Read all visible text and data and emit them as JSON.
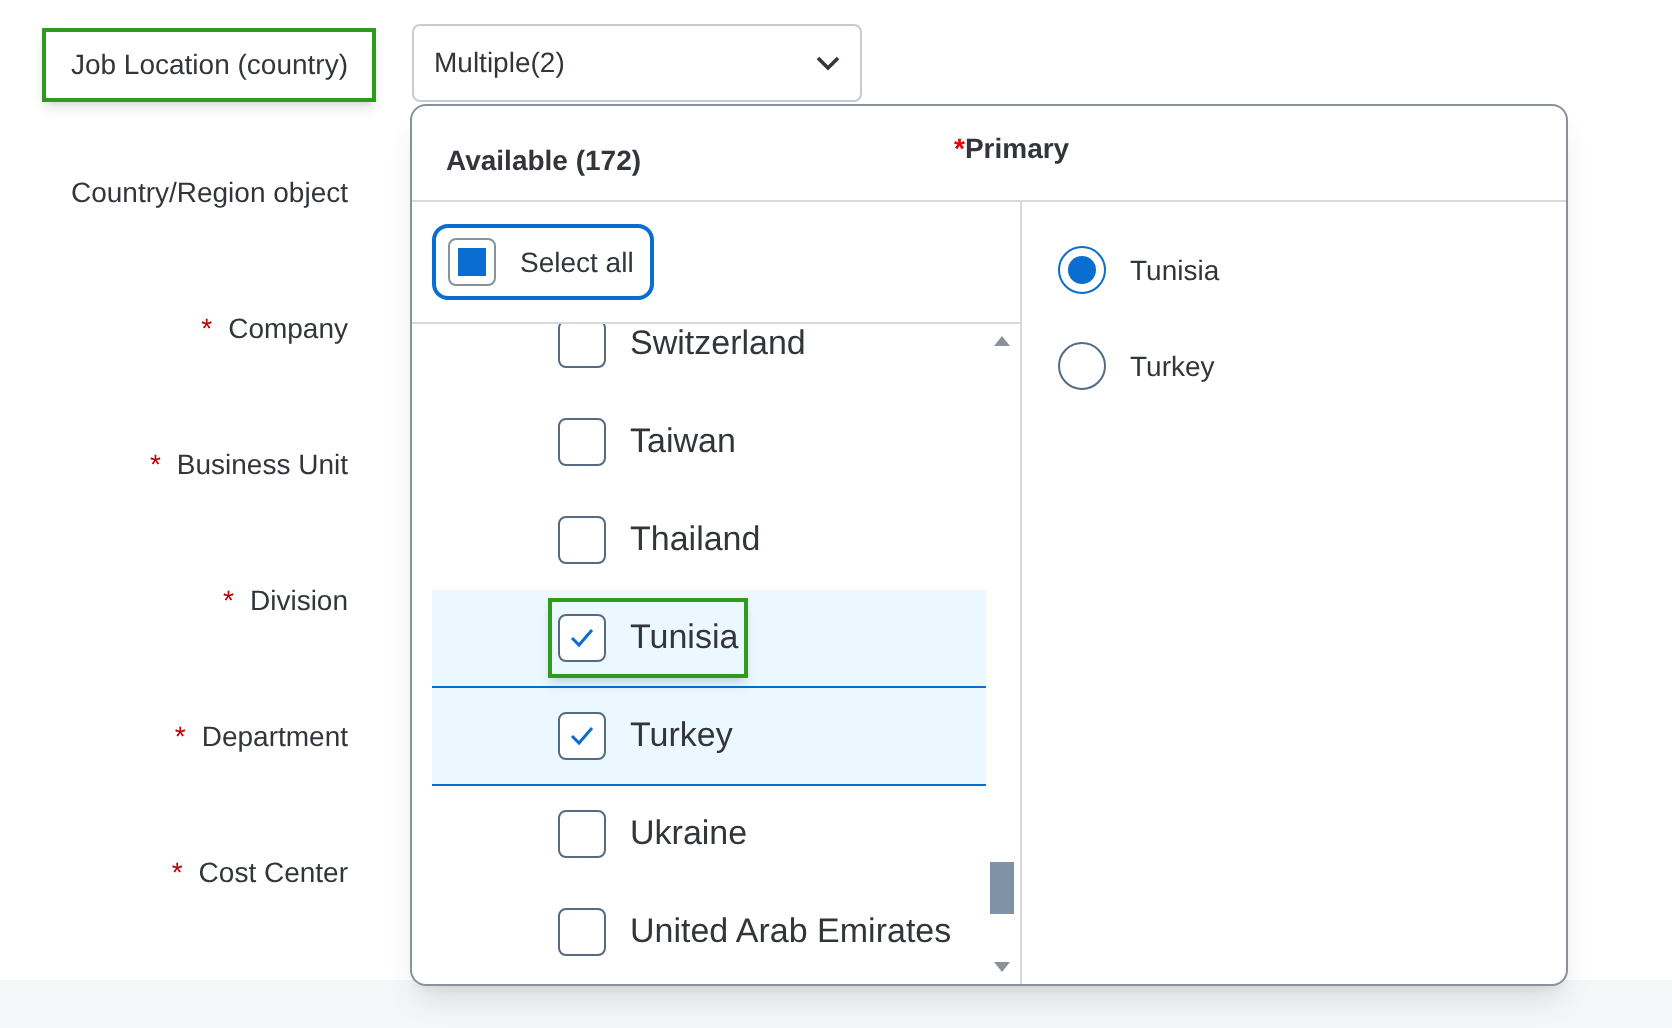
{
  "fields": [
    {
      "label": "Job Location (country)",
      "required": false,
      "highlighted": true
    },
    {
      "label": "Country/Region object",
      "required": false,
      "highlighted": false
    },
    {
      "label": "Company",
      "required": true,
      "required_mark": "*",
      "highlighted": false
    },
    {
      "label": "Business Unit",
      "required": true,
      "required_mark": "*",
      "highlighted": false
    },
    {
      "label": "Division",
      "required": true,
      "required_mark": "*",
      "highlighted": false
    },
    {
      "label": "Department",
      "required": true,
      "required_mark": "*",
      "highlighted": false
    },
    {
      "label": "Cost Center",
      "required": true,
      "required_mark": "*",
      "highlighted": false
    }
  ],
  "dropdown": {
    "value": "Multiple(2)"
  },
  "popup": {
    "available_title": "Available (172)",
    "primary_title": "Primary",
    "primary_required": true,
    "primary_required_mark": "*",
    "select_all": {
      "label": "Select all",
      "indeterminate": true
    },
    "items": [
      {
        "label": "Switzerland",
        "checked": false,
        "highlighted": false
      },
      {
        "label": "Taiwan",
        "checked": false,
        "highlighted": false
      },
      {
        "label": "Thailand",
        "checked": false,
        "highlighted": false
      },
      {
        "label": "Tunisia",
        "checked": true,
        "highlighted": true
      },
      {
        "label": "Turkey",
        "checked": true,
        "highlighted": false
      },
      {
        "label": "Ukraine",
        "checked": false,
        "highlighted": false
      },
      {
        "label": "United Arab Emirates",
        "checked": false,
        "highlighted": false
      }
    ],
    "primary_options": [
      {
        "label": "Tunisia",
        "selected": true
      },
      {
        "label": "Turkey",
        "selected": false
      }
    ]
  }
}
